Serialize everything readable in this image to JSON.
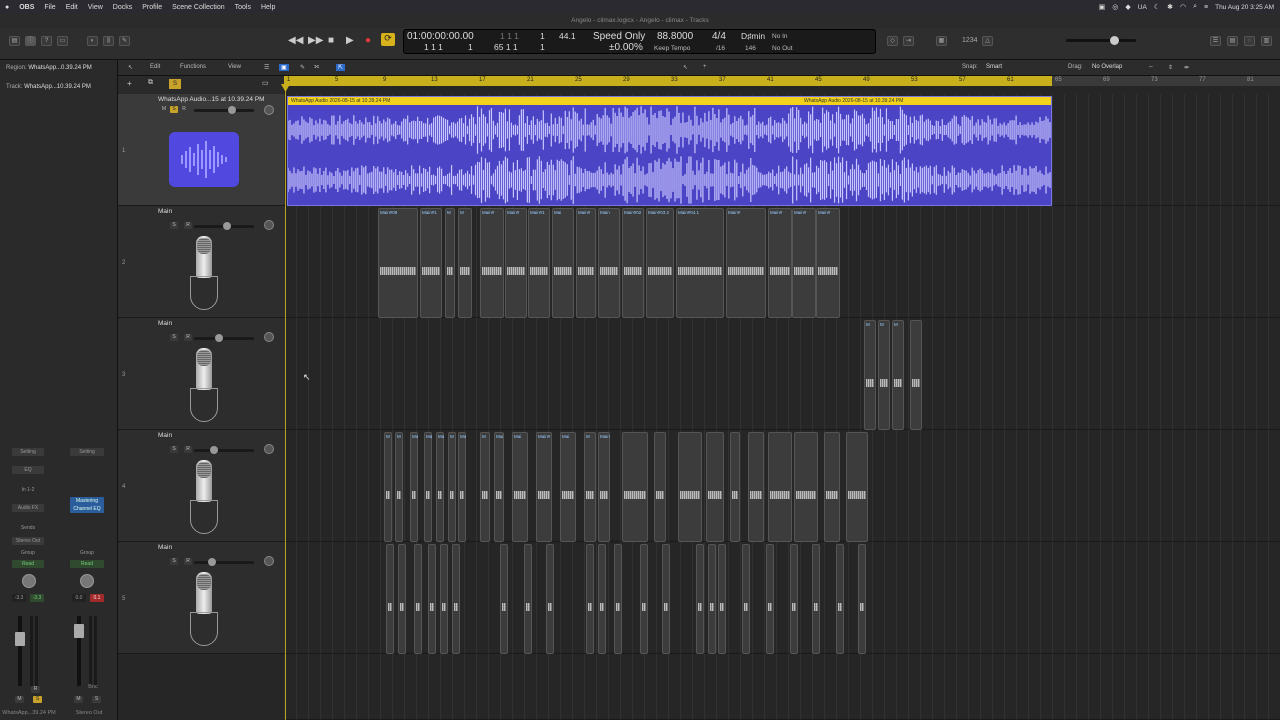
{
  "menubar": {
    "app": "OBS",
    "items": [
      "File",
      "Edit",
      "View",
      "Docks",
      "Profile",
      "Scene Collection",
      "Tools",
      "Help"
    ],
    "input_source": "UA",
    "clock": "Thu Aug 20  3:25 AM"
  },
  "window_title": "Angelo - climax.logicx - Angelo - climax - Tracks",
  "lcd": {
    "smpte": "01:00:00:00.00",
    "bars_top": "1 1 1",
    "bars_top_2": "1",
    "bars_bottom": "1 1 1",
    "bars_bottom_2": "1",
    "end_top": "1 1 1",
    "end_bottom": "65 1 1",
    "end_bottom_2": "1",
    "sample_rate": "44.1",
    "mode": "Speed Only",
    "tempo": "88.8000",
    "tempo_change": "±0.00%",
    "keep": "Keep Tempo",
    "signature": "4/4",
    "division": "/16",
    "key": "D♯min",
    "key_num": "146",
    "in": "No In",
    "out": "No Out",
    "count": "1234"
  },
  "inspector": {
    "region_label": "Region:",
    "region_name": "WhatsApp...0.39.24 PM",
    "track_label": "Track:",
    "track_name": "WhatsApp...10.39.24 PM",
    "strip1": {
      "setting": "Setting",
      "eq": "EQ",
      "input": "In 1-2",
      "audio_fx": "Audio FX",
      "sends": "Sends",
      "output": "Stereo Out",
      "group": "Group",
      "auto": "Read",
      "vol": "-3.3",
      "vol2": "-3.3",
      "name": "WhatsApp...39.24 PM"
    },
    "strip2": {
      "setting": "Setting",
      "plugin": "Mastering Channel EQ",
      "group": "Group",
      "auto": "Read",
      "vol": "0.0",
      "peak": "0.1",
      "bnc": "Bnc",
      "name": "Stereo Out"
    }
  },
  "toolbar": {
    "edit": "Edit",
    "functions": "Functions",
    "view": "View",
    "snap_label": "Snap:",
    "snap_value": "Smart",
    "drag_label": "Drag:",
    "drag_value": "No Overlap"
  },
  "ruler_ticks": [
    "1",
    "5",
    "9",
    "13",
    "17",
    "21",
    "25",
    "29",
    "33",
    "37",
    "41",
    "45",
    "49",
    "53",
    "57",
    "61",
    "65",
    "69",
    "73",
    "77",
    "81"
  ],
  "tracks": [
    {
      "num": "1",
      "name": "WhatsApp Audio...15 at 10.39.24 PM",
      "region_a": "WhatsApp Audio 2026-08-15 at 10.39.24 PM",
      "region_b": "WhatsApp Audio 2026-08-15 at 10.39.24 PM"
    },
    {
      "num": "2",
      "name": "Main"
    },
    {
      "num": "3",
      "name": "Main"
    },
    {
      "num": "4",
      "name": "Main"
    },
    {
      "num": "5",
      "name": "Main"
    }
  ],
  "clips2": [
    "Main#08",
    "Main#1",
    "M",
    "M",
    "Main#",
    "Main#",
    "Main#1",
    "Mai",
    "Main#",
    "Main",
    "Main#02",
    "Main#03.2",
    "Main#04.1",
    "Main#",
    "Main#",
    "Main#",
    "Main#"
  ],
  "clips3": [
    "M",
    "M",
    "M"
  ],
  "clips4": [
    "M",
    "M",
    "Mai",
    "Mai",
    "Mai",
    "M",
    "Main#",
    "M",
    "Mai",
    "Mai",
    "Main#",
    "Mai",
    "M",
    "Main"
  ],
  "colors": {
    "region": "#4b44c4",
    "region_header": "#f2d21a",
    "ruler": "#c8b01c",
    "background": "#262626"
  }
}
